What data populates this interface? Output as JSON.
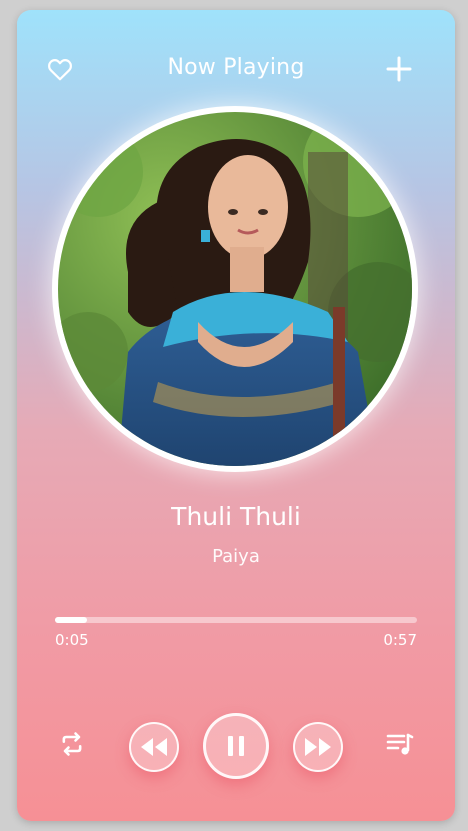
{
  "header": {
    "title": "Now Playing",
    "favorite_icon": "heart-icon",
    "add_icon": "plus-icon"
  },
  "track": {
    "title": "Thuli Thuli",
    "artist": "Paiya",
    "album_art": "album-art-photo"
  },
  "progress": {
    "elapsed": "0:05",
    "duration": "0:57",
    "fraction": 0.088
  },
  "controls": {
    "repeat_icon": "repeat-icon",
    "rewind_icon": "rewind-icon",
    "pause_icon": "pause-icon",
    "forward_icon": "fast-forward-icon",
    "playlist_icon": "playlist-icon"
  },
  "colors": {
    "gradient_top": "#9fe2fb",
    "gradient_bottom": "#f69095",
    "foreground": "#ffffff"
  }
}
